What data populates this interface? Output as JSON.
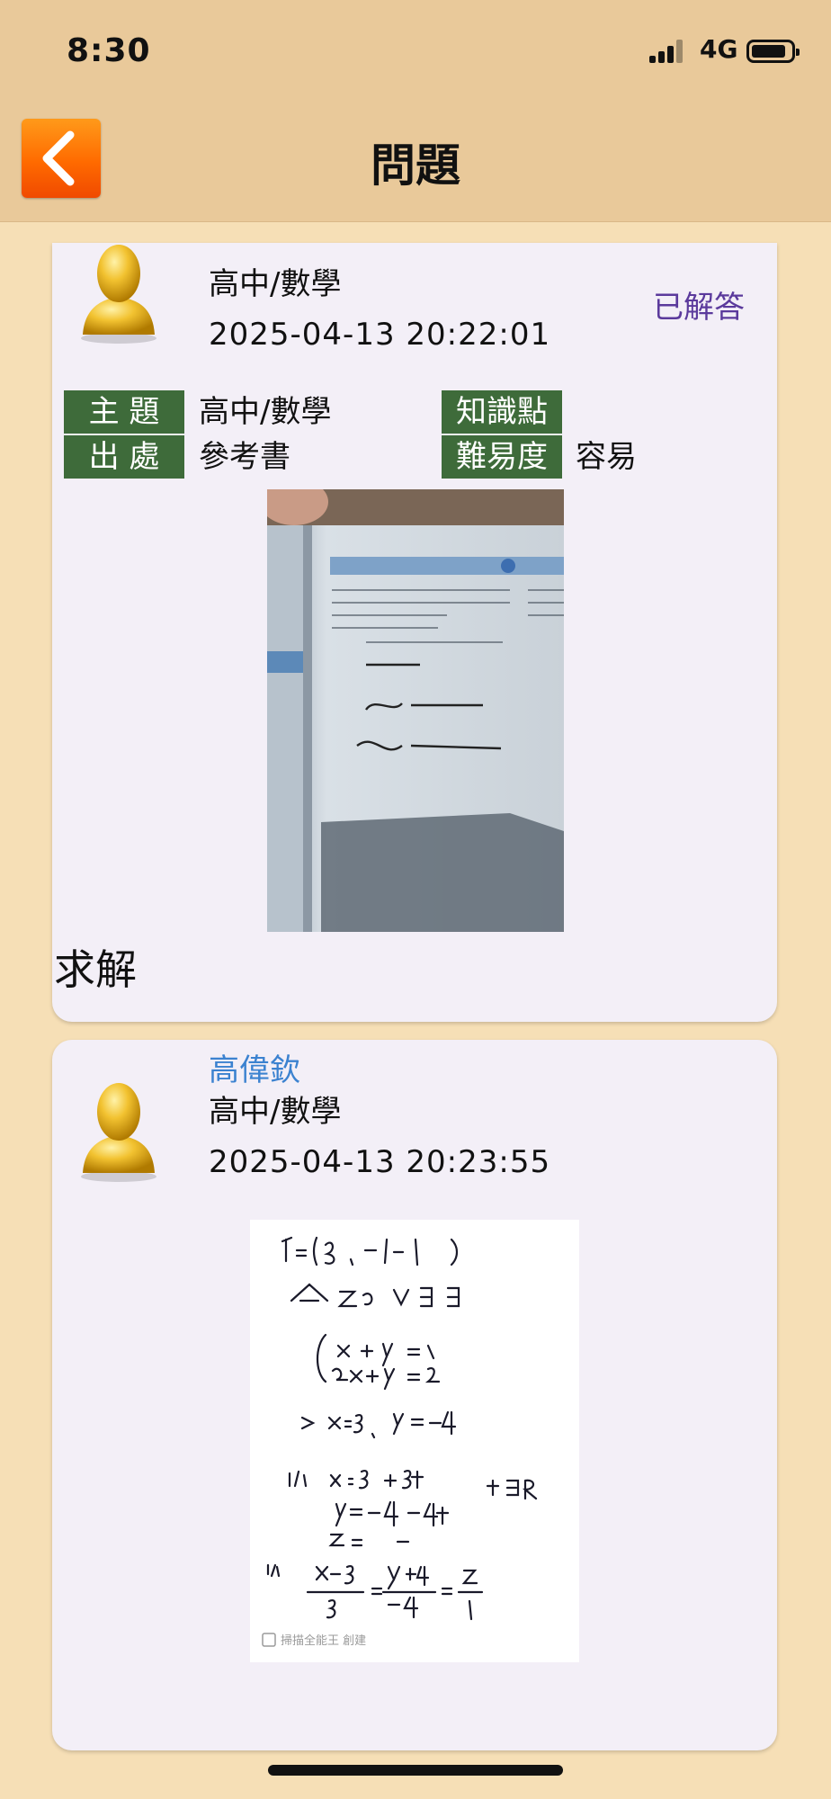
{
  "status_bar": {
    "time": "8:30",
    "network": "4G"
  },
  "nav": {
    "title": "問題",
    "back_icon": "chevron-left-icon"
  },
  "question": {
    "subject": "高中/數學",
    "timestamp": "2025-04-13 20:22:01",
    "status": "已解答",
    "fields": {
      "topic_label": "主 題",
      "topic_value": "高中/數學",
      "source_label": "出 處",
      "source_value": "參考書",
      "knowledge_label": "知識點",
      "knowledge_value": "",
      "difficulty_label": "難易度",
      "difficulty_value": "容易"
    },
    "text": "求解"
  },
  "answer": {
    "author": "高偉欽",
    "subject": "高中/數學",
    "timestamp": "2025-04-13 20:23:55",
    "watermark": "掃描全能王 創建"
  }
}
